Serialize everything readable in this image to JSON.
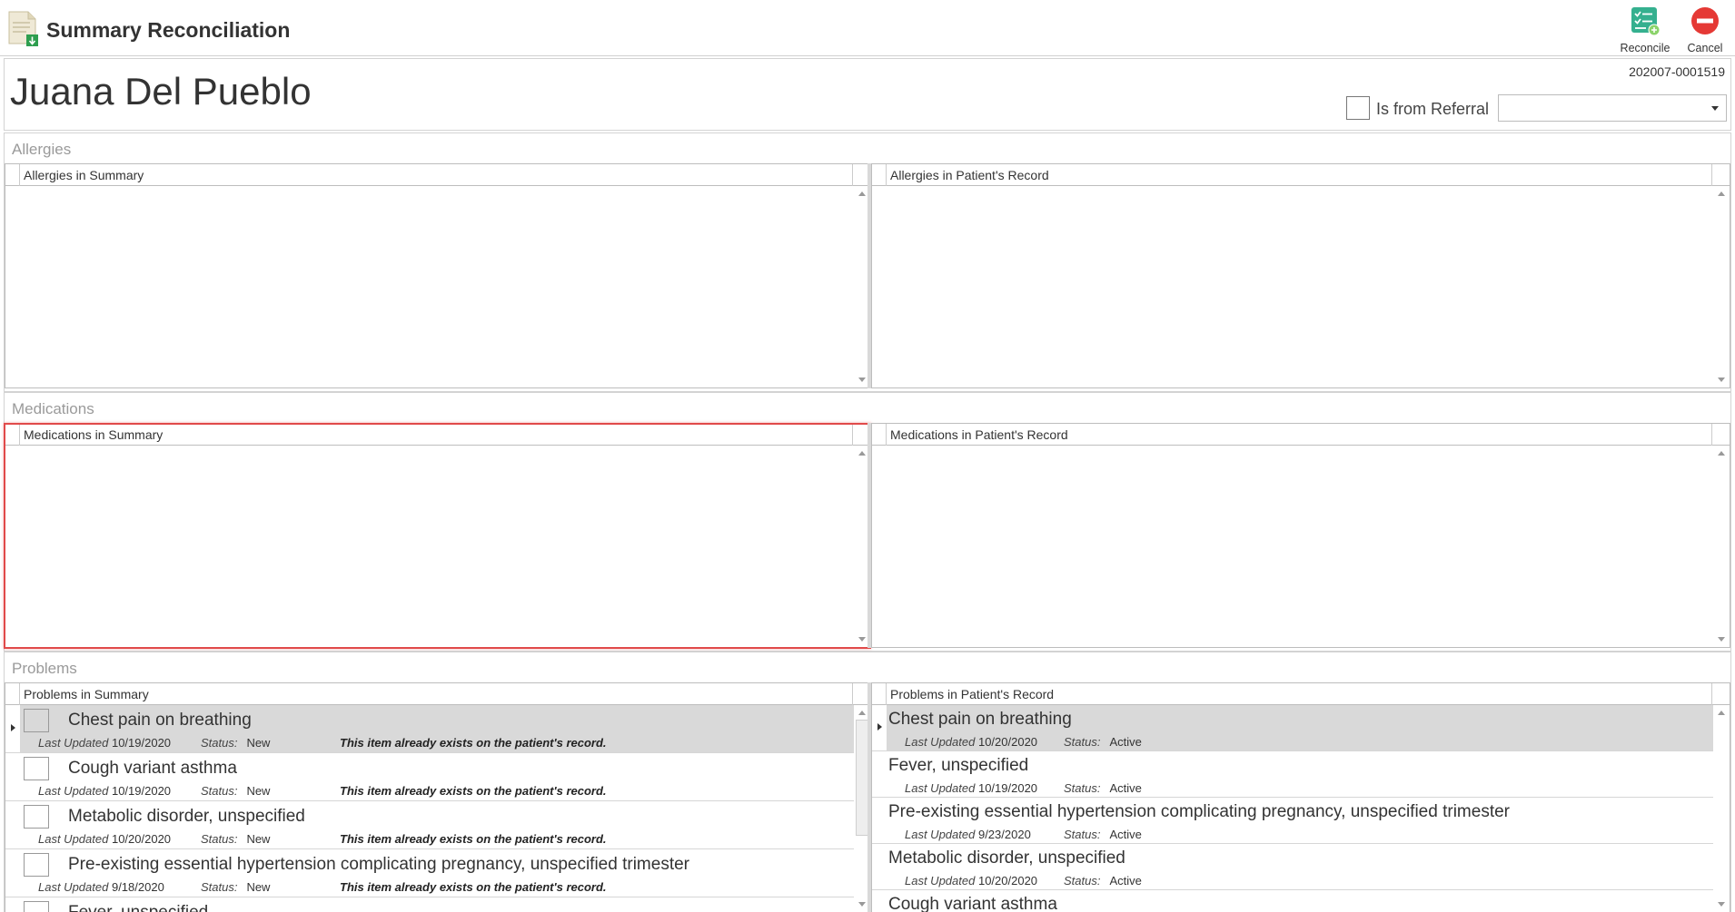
{
  "app": {
    "title": "Summary Reconciliation",
    "icon": "document-import-icon"
  },
  "toolbar": {
    "reconcile_label": "Reconcile",
    "cancel_label": "Cancel",
    "reconcile_color": "#2daa8a",
    "cancel_color": "#e53935"
  },
  "patient": {
    "name": "Juana Del Pueblo",
    "record_id": "202007-0001519",
    "referral_label": "Is from Referral",
    "referral_checked": false,
    "referral_value": ""
  },
  "sections": {
    "allergies": {
      "title": "Allergies",
      "left_header": "Allergies in Summary",
      "right_header": "Allergies in Patient's Record"
    },
    "medications": {
      "title": "Medications",
      "left_header": "Medications in Summary",
      "right_header": "Medications in Patient's Record",
      "highlight_color": "#e14a4a"
    },
    "problems": {
      "title": "Problems",
      "left_header": "Problems in Summary",
      "right_header": "Problems in Patient's Record",
      "last_updated_label": "Last Updated",
      "status_label": "Status:",
      "summary_items": [
        {
          "name": "Chest pain on breathing",
          "last_updated": "10/19/2020",
          "status": "New",
          "note": "This item already exists on the patient's record.",
          "selected": true
        },
        {
          "name": "Cough variant asthma",
          "last_updated": "10/19/2020",
          "status": "New",
          "note": "This item already exists on the patient's record.",
          "selected": false
        },
        {
          "name": "Metabolic disorder, unspecified",
          "last_updated": "10/20/2020",
          "status": "New",
          "note": "This item already exists on the patient's record.",
          "selected": false
        },
        {
          "name": "Pre-existing essential hypertension complicating pregnancy, unspecified trimester",
          "last_updated": "9/18/2020",
          "status": "New",
          "note": "This item already exists on the patient's record.",
          "selected": false
        },
        {
          "name": "Fever, unspecified",
          "last_updated": "",
          "status": "",
          "note": "",
          "selected": false
        }
      ],
      "record_items": [
        {
          "name": "Chest pain on breathing",
          "last_updated": "10/20/2020",
          "status": "Active",
          "selected": true
        },
        {
          "name": "Fever, unspecified",
          "last_updated": "10/19/2020",
          "status": "Active",
          "selected": false
        },
        {
          "name": "Pre-existing essential hypertension complicating pregnancy, unspecified trimester",
          "last_updated": "9/23/2020",
          "status": "Active",
          "selected": false
        },
        {
          "name": "Metabolic disorder, unspecified",
          "last_updated": "10/20/2020",
          "status": "Active",
          "selected": false
        },
        {
          "name": "Cough variant asthma",
          "last_updated": "",
          "status": "",
          "selected": false
        }
      ]
    }
  }
}
